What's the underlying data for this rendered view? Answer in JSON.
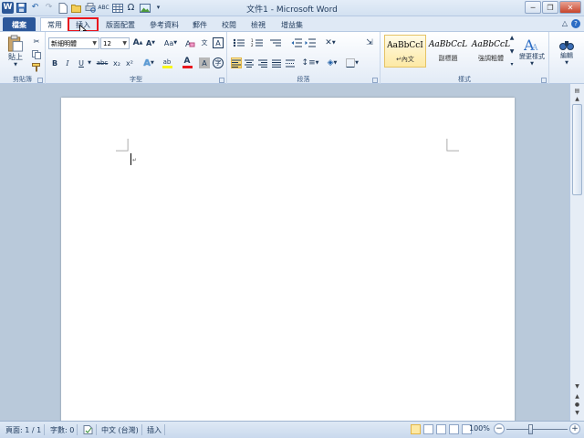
{
  "window": {
    "title": "文件1 - Microsoft Word",
    "app_icon": "W"
  },
  "quick_access": {
    "icons": [
      "save-icon",
      "undo-icon",
      "redo-icon",
      "new-document-icon",
      "open-icon",
      "print-preview-icon",
      "spelling-icon",
      "table-icon",
      "omega-icon",
      "insert-picture-icon",
      "customize-icon"
    ]
  },
  "tabs": {
    "file": "檔案",
    "home": "常用",
    "insert": "插入",
    "layout": "版面配置",
    "references": "參考資料",
    "mailings": "郵件",
    "review": "校閱",
    "view": "檢視",
    "developer": "增益集"
  },
  "ribbon": {
    "clipboard": {
      "label": "剪貼簿",
      "paste_label": "貼上"
    },
    "font": {
      "label": "字型",
      "font_name": "新細明體",
      "font_size": "12",
      "bold": "B",
      "italic": "I",
      "underline": "U",
      "strike": "abc",
      "subscript": "x₂",
      "superscript": "x²",
      "change_case": "Aa",
      "grow": "A",
      "shrink": "A",
      "font_color": "A",
      "highlight": "ab"
    },
    "paragraph": {
      "label": "段落"
    },
    "styles": {
      "label": "樣式",
      "items": [
        {
          "sample": "AaBbCcI",
          "name": "↵內文"
        },
        {
          "sample": "AaBbCcL",
          "name": "副標題"
        },
        {
          "sample": "AaBbCcL",
          "name": "強調粗體"
        }
      ],
      "change_styles": "變更樣式"
    },
    "editing": {
      "label": "編輯"
    }
  },
  "statusbar": {
    "page": "頁面: 1 / 1",
    "words": "字數: 0",
    "language": "中文 (台灣)",
    "mode": "插入",
    "zoom": "100%"
  },
  "colors": {
    "file_tab": "#2b579a",
    "highlight_box": "#e8161e",
    "font_color_bar": "#e8161e",
    "highlight_color_bar": "#f7f719"
  }
}
